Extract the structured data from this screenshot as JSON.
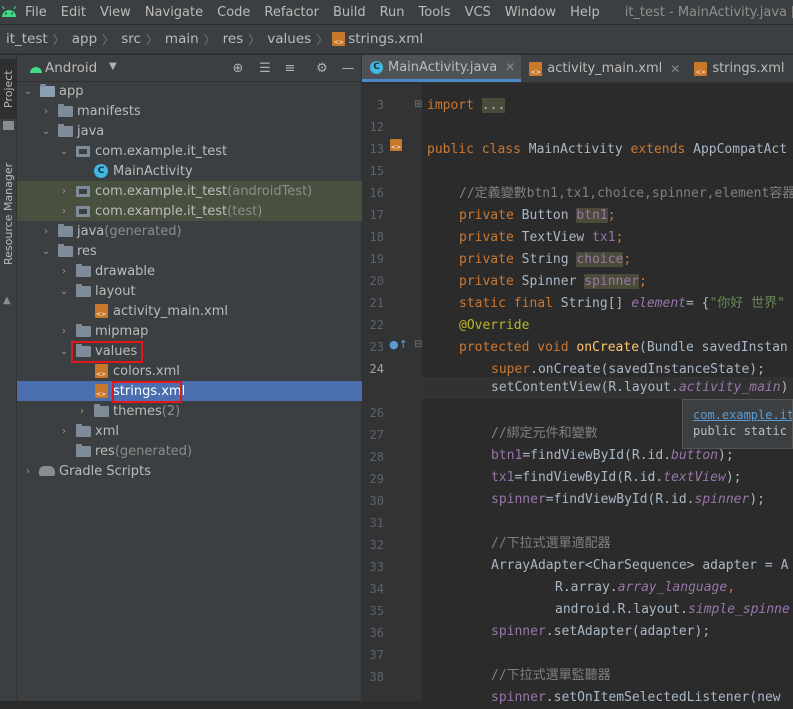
{
  "menu": [
    "File",
    "Edit",
    "View",
    "Navigate",
    "Code",
    "Refactor",
    "Build",
    "Run",
    "Tools",
    "VCS",
    "Window",
    "Help"
  ],
  "window_title": "it_test - MainActivity.java [it_test.app.ma",
  "breadcrumb": [
    "it_test",
    "app",
    "src",
    "main",
    "res",
    "values",
    "strings.xml"
  ],
  "side_tabs": {
    "project": "Project",
    "resource_manager": "Resource Manager"
  },
  "project_view": "Android",
  "tree": [
    {
      "label": "app",
      "suffix": ""
    },
    {
      "label": "manifests",
      "suffix": ""
    },
    {
      "label": "java",
      "suffix": ""
    },
    {
      "label": "com.example.it_test",
      "suffix": ""
    },
    {
      "label": "MainActivity",
      "suffix": ""
    },
    {
      "label": "com.example.it_test",
      "suffix": " (androidTest)"
    },
    {
      "label": "com.example.it_test",
      "suffix": " (test)"
    },
    {
      "label": "java",
      "suffix": " (generated)"
    },
    {
      "label": "res",
      "suffix": ""
    },
    {
      "label": "drawable",
      "suffix": ""
    },
    {
      "label": "layout",
      "suffix": ""
    },
    {
      "label": "activity_main.xml",
      "suffix": ""
    },
    {
      "label": "mipmap",
      "suffix": ""
    },
    {
      "label": "values",
      "suffix": ""
    },
    {
      "label": "colors.xml",
      "suffix": ""
    },
    {
      "label": "strings.xml",
      "suffix": ""
    },
    {
      "label": "themes",
      "suffix": " (2)"
    },
    {
      "label": "xml",
      "suffix": ""
    },
    {
      "label": "res",
      "suffix": " (generated)"
    },
    {
      "label": "Gradle Scripts",
      "suffix": ""
    }
  ],
  "tabs": [
    {
      "label": "MainActivity.java",
      "active": true
    },
    {
      "label": "activity_main.xml",
      "active": false
    },
    {
      "label": "strings.xml",
      "active": false
    }
  ],
  "line_numbers": [
    "3",
    "12",
    "13",
    "15",
    "16",
    "17",
    "18",
    "19",
    "20",
    "21",
    "22",
    "23",
    "24",
    "26",
    "27",
    "28",
    "29",
    "30",
    "31",
    "32",
    "33",
    "34",
    "35",
    "36",
    "37",
    "38"
  ],
  "code": {
    "l3a": "import ",
    "l3b": "...",
    "l13a": "public class ",
    "l13b": "MainActivity ",
    "l13c": "extends ",
    "l13d": "AppCompatAct",
    "l15": "//定義變數btn1,tx1,choice,spinner,element容器",
    "l16a": "private ",
    "l16b": "Button ",
    "l16c": "btn1",
    "l17a": "private ",
    "l17b": "TextView ",
    "l17c": "tx1",
    "l18a": "private ",
    "l18b": "String ",
    "l18c": "choice",
    "l19a": "private ",
    "l19b": "Spinner ",
    "l19c": "spinner",
    "l20a": "static final ",
    "l20b": "String[] ",
    "l20c": "element",
    "l20d": "= {",
    "l20e": "\"你好 世界\"",
    "l21": "@Override",
    "l22a": "protected void ",
    "l22b": "onCreate",
    "l22c": "(Bundle savedInstan",
    "l23a": "super",
    "l23b": ".onCreate(savedInstanceState);",
    "l24a": "setContentView(R.layout.",
    "l24b": "activity_main",
    ")": ")",
    "l26": "//綁定元件和變數",
    "l27a": "btn1",
    "l27b": "=findViewById(R.id.",
    "l27c": "button",
    "l28a": "tx1",
    "l28b": "=findViewById(R.id.",
    "l28c": "textView",
    "l28d": ");",
    "l29a": "spinner",
    "l29b": "=findViewById(R.id.",
    "l29c": "spinner",
    "l29d": ");",
    "l31": "//下拉式選單適配器",
    "l32": "ArrayAdapter<CharSequence> adapter = A",
    "l33a": "R.array.",
    "l33b": "array_language",
    "l34a": "android.R.layout.",
    "l34b": "simple_spinne",
    "l35a": "spinner",
    ".": ".setAdapter(adapter);",
    "l37": "//下拉式選單監聽器",
    "l38a": "spinner",
    ".2": ".setOnItemSelectedListener(new "
  },
  "tooltip": {
    "line1": "com.example.it_",
    "line2": "public static"
  }
}
